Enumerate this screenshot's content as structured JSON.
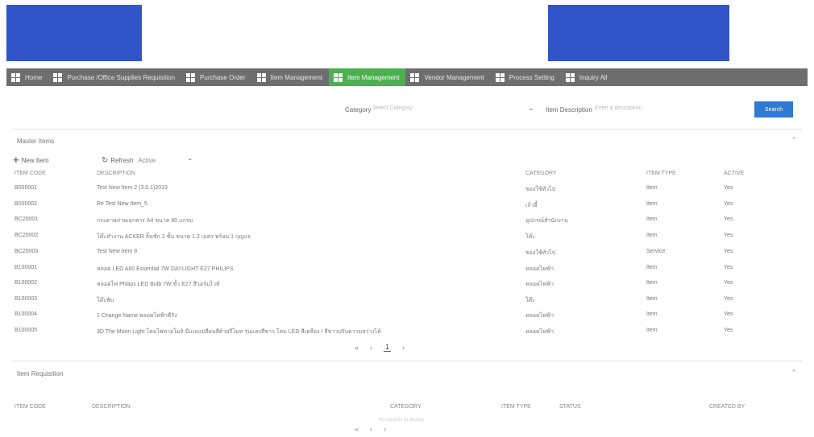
{
  "nav": [
    {
      "label": "Home",
      "active": false
    },
    {
      "label": "Purchase /Office Supplies Requisition",
      "active": false
    },
    {
      "label": "Purchase Order",
      "active": false
    },
    {
      "label": "Item Management",
      "active": false
    },
    {
      "label": "Item Management",
      "active": true
    },
    {
      "label": "Vendor Management",
      "active": false
    },
    {
      "label": "Process Setting",
      "active": false
    },
    {
      "label": "Inquiry All",
      "active": false
    }
  ],
  "filters": {
    "category_label": "Category",
    "category_placeholder": "Select Category",
    "desc_label": "Item Description",
    "desc_placeholder": "Enter a description",
    "search_label": "Search"
  },
  "master": {
    "title": "Master Items",
    "new_label": "New Item",
    "refresh_label": "Refresh",
    "active_label": "Active",
    "columns": [
      "ITEM CODE",
      "DESCRIPTION",
      "CATEGORY",
      "ITEM TYPE",
      "ACTIVE"
    ],
    "rows": [
      [
        "B000001",
        "Test New Item 2 (3.0.1)2019",
        "ของใช้ทั่วไป",
        "Item",
        "Yes"
      ],
      [
        "B000002",
        "Re Test New Item_5",
        "เก้าอี้",
        "Item",
        "Yes"
      ],
      [
        "BC20001",
        "กระดาษถ่ายเอกสาร A4 ขนาด 80 แกรม",
        "อุปกรณ์สำนักงาน",
        "Item",
        "Yes"
      ],
      [
        "BC20002",
        "โต๊ะทำงาน ACKER ลิ้นชัก 2 ชั้น ขนาด 1.2 เมตร พร้อม 1 กุญแจ",
        "โต๊ะ",
        "Item",
        "Yes"
      ],
      [
        "BC20003",
        "Test New Item 8",
        "ของใช้ทั่วไป",
        "Service",
        "Yes"
      ],
      [
        "B100001",
        "หลอด LED A60 Essential 7W DAYLIGHT E27 PHILIPS",
        "หลอดไฟฟ้า",
        "Item",
        "Yes"
      ],
      [
        "B100002",
        "หลอดไฟ Philips LED Bulb 7W ขั้ว E27 สีวอร์มไวท์",
        "หลอดไฟฟ้า",
        "Item",
        "Yes"
      ],
      [
        "B100003",
        "โต๊ะพับ",
        "โต๊ะ",
        "Item",
        "Yes"
      ],
      [
        "B100004",
        "1 Change Name หลอดไฟฟ้าดีรัง",
        "หลอดไฟฟ้า",
        "Item",
        "Yes"
      ],
      [
        "B100005",
        "3D The Moon Light โคมไฟลายโมจิ มีแบบเปลี่ยนสีด้วยรีโมท รุ่นแสงสีขาว โคม LED สีเหลือง / สีขาวปรับความสว่างได้",
        "หลอดไฟฟ้า",
        "Item",
        "Yes"
      ]
    ],
    "pager": {
      "first": "«",
      "prev": "‹",
      "page": "1",
      "next": "›"
    }
  },
  "requisition": {
    "title": "Item Requisition",
    "columns": [
      "ITEM CODE",
      "DESCRIPTION",
      "CATEGORY",
      "ITEM TYPE",
      "STATUS",
      "CREATED BY"
    ],
    "empty": "No records to display",
    "pager": {
      "first": "«",
      "prev": "‹",
      "next": "›"
    }
  },
  "colors": {
    "nav_bg": "#6e6e6e",
    "nav_active": "#4cb050",
    "search_btn": "#2f79d3",
    "logo_blue": "#3155c9"
  }
}
